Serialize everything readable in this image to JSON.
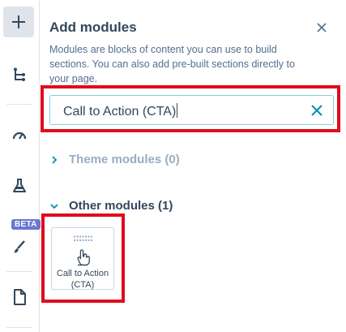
{
  "sidebar": {
    "beta_badge": "BETA",
    "items": [
      {
        "icon": "plus-icon"
      },
      {
        "icon": "tree-structure-icon"
      },
      {
        "icon": "gauge-icon"
      },
      {
        "icon": "flask-icon"
      },
      {
        "icon": "brush-icon"
      },
      {
        "icon": "document-icon"
      }
    ]
  },
  "panel": {
    "title": "Add modules",
    "description": "Modules are blocks of content you can use to build sections. You can also add pre-built sections directly to your page.",
    "search": {
      "value": "Call to Action (CTA)"
    },
    "sections": [
      {
        "label": "Theme modules (0)",
        "expanded": false
      },
      {
        "label": "Other modules (1)",
        "expanded": true
      }
    ],
    "modules": [
      {
        "label": "Call to Action (CTA)"
      }
    ]
  },
  "colors": {
    "highlight": "#e00b1c",
    "accent": "#0091ae",
    "search_border": "#7fd1de",
    "beta": "#6a78d1"
  }
}
